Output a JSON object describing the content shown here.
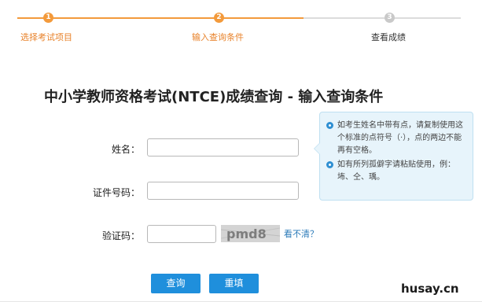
{
  "stepper": {
    "steps": [
      {
        "number": "1",
        "label": "选择考试项目",
        "state": "done"
      },
      {
        "number": "2",
        "label": "输入查询条件",
        "state": "active"
      },
      {
        "number": "3",
        "label": "查看成绩",
        "state": "inactive"
      }
    ]
  },
  "page_title": "中小学教师资格考试(NTCE)成绩查询 - 输入查询条件",
  "form": {
    "name_label": "姓名：",
    "name_value": "",
    "id_label": "证件号码：",
    "id_value": "",
    "captcha_label": "验证码：",
    "captcha_value": "",
    "captcha_text": "pmd8",
    "refresh_label": "看不清？"
  },
  "tips": [
    "如考生姓名中带有点，请复制使用这个标准的点符号（·），点的两边不能再有空格。",
    "如有所列孤僻字请粘贴使用，例：㘵、仝、瑀。"
  ],
  "buttons": {
    "query_label": "查询",
    "reset_label": "重填"
  },
  "watermark": "husay.cn",
  "colors": {
    "accent_orange": "#f39a3b",
    "button_blue": "#1f8fdc",
    "tip_background": "#e7f4fb"
  }
}
